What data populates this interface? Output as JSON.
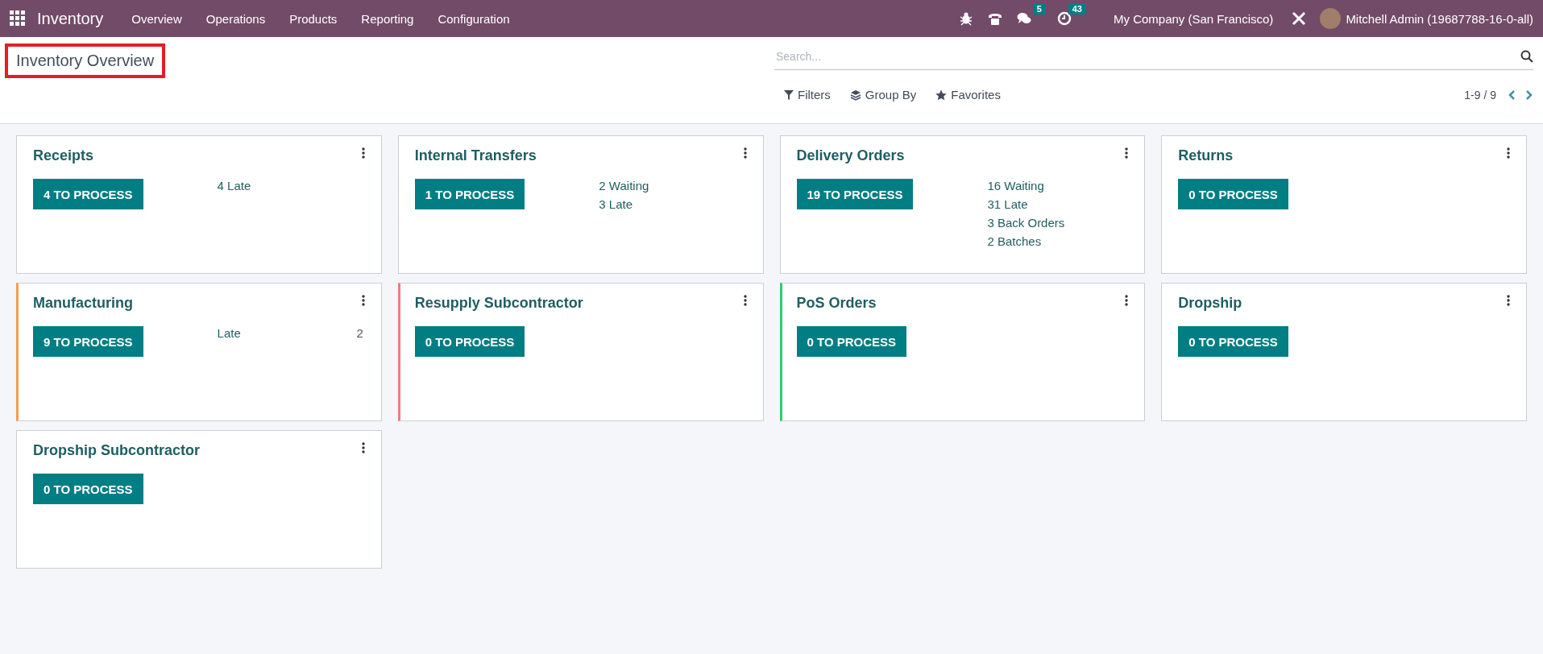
{
  "navbar": {
    "app_name": "Inventory",
    "menu": [
      "Overview",
      "Operations",
      "Products",
      "Reporting",
      "Configuration"
    ],
    "messages_badge": "5",
    "activities_badge": "43",
    "company": "My Company (San Francisco)",
    "user": "Mitchell Admin (19687788-16-0-all)"
  },
  "control_panel": {
    "title": "Inventory Overview",
    "search": {
      "placeholder": "Search..."
    },
    "filters": [
      "Filters",
      "Group By",
      "Favorites"
    ],
    "pager": "1-9 / 9"
  },
  "cards": [
    {
      "title": "Receipts",
      "button": "4 TO PROCESS",
      "stats": [
        {
          "label": "4 Late"
        }
      ]
    },
    {
      "title": "Internal Transfers",
      "button": "1 TO PROCESS",
      "stats": [
        {
          "label": "2 Waiting"
        },
        {
          "label": "3 Late"
        }
      ]
    },
    {
      "title": "Delivery Orders",
      "button": "19 TO PROCESS",
      "stats": [
        {
          "label": "16 Waiting"
        },
        {
          "label": "31 Late"
        },
        {
          "label": "3 Back Orders"
        },
        {
          "label": "2 Batches"
        }
      ]
    },
    {
      "title": "Returns",
      "button": "0 TO PROCESS"
    },
    {
      "title": "Manufacturing",
      "button": "9 TO PROCESS",
      "color": "#f0a050",
      "stats": [
        {
          "label": "Late",
          "value": "2"
        }
      ]
    },
    {
      "title": "Resupply Subcontractor",
      "button": "0 TO PROCESS",
      "color": "#e88080"
    },
    {
      "title": "PoS Orders",
      "button": "0 TO PROCESS",
      "color": "#2ecc71"
    },
    {
      "title": "Dropship",
      "button": "0 TO PROCESS"
    },
    {
      "title": "Dropship Subcontractor",
      "button": "0 TO PROCESS"
    }
  ]
}
